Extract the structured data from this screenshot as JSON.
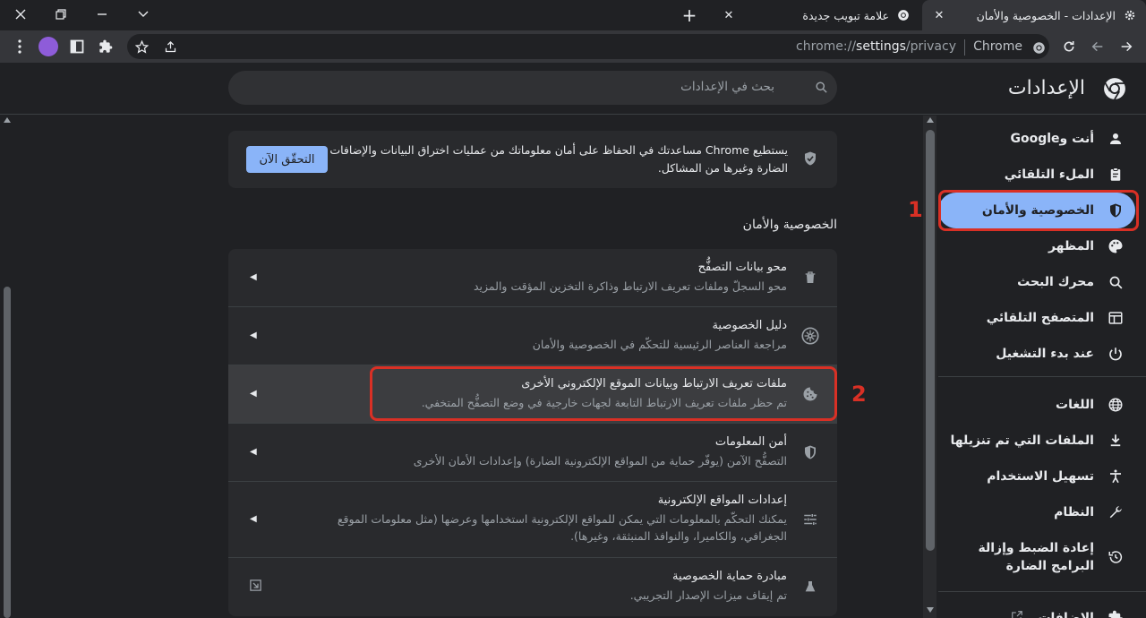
{
  "tabs": [
    {
      "title": "الإعدادات - الخصوصية والأمان",
      "icon": "settings-gear-icon",
      "active": true
    },
    {
      "title": "علامة تبويب جديدة",
      "icon": "chrome-icon",
      "active": false
    }
  ],
  "toolbar": {
    "url_prefix": "chrome://",
    "url_bold": "settings",
    "url_suffix": "/privacy",
    "chip": "Chrome"
  },
  "header": {
    "title": "الإعدادات",
    "search_placeholder": "بحث في الإعدادات"
  },
  "sidebar": {
    "items": [
      {
        "label": "أنت وGoogle",
        "icon": "person-icon"
      },
      {
        "label": "الملء التلقائي",
        "icon": "clipboard-icon"
      },
      {
        "label": "الخصوصية والأمان",
        "icon": "shield-icon",
        "selected": true
      },
      {
        "label": "المظهر",
        "icon": "palette-icon"
      },
      {
        "label": "محرك البحث",
        "icon": "search-icon"
      },
      {
        "label": "المتصفح التلقائي",
        "icon": "browser-icon"
      },
      {
        "label": "عند بدء التشغيل",
        "icon": "power-icon"
      },
      {
        "label": "اللغات",
        "icon": "globe-icon"
      },
      {
        "label": "الملفات التي تم تنزيلها",
        "icon": "download-icon"
      },
      {
        "label": "تسهيل الاستخدام",
        "icon": "accessibility-icon"
      },
      {
        "label": "النظام",
        "icon": "wrench-icon"
      },
      {
        "label": "إعادة الضبط وإزالة البرامج الضارة",
        "icon": "restore-icon"
      },
      {
        "label": "الإضافات",
        "icon": "puzzle-icon"
      }
    ]
  },
  "safety_check": {
    "text_line1": "يستطيع Chrome مساعدتك في الحفاظ على أمان معلوماتك من عمليات اختراق البيانات والإضافات",
    "text_line2": "الضارة وغيرها من المشاكل.",
    "button": "التحقّق الآن"
  },
  "section_title": "الخصوصية والأمان",
  "rows": [
    {
      "title": "محو بيانات التصفُّح",
      "subtitle": "محو السجلّ وملفات تعريف الارتباط وذاكرة التخزين المؤقت والمزيد",
      "icon": "trash-icon"
    },
    {
      "title": "دليل الخصوصية",
      "subtitle": "مراجعة العناصر الرئيسية للتحكّم في الخصوصية والأمان",
      "icon": "compass-icon"
    },
    {
      "title": "ملفات تعريف الارتباط وبيانات الموقع الإلكتروني الأخرى",
      "subtitle": "تم حظر ملفات تعريف الارتباط التابعة لجهات خارجية في وضع التصفُّح المتخفي.",
      "icon": "cookie-icon"
    },
    {
      "title": "أمن المعلومات",
      "subtitle": "التصفُّح الآمن (يوفّر حماية من المواقع الإلكترونية الضارة) وإعدادات الأمان الأخرى",
      "icon": "shield-icon"
    },
    {
      "title": "إعدادات المواقع الإلكترونية",
      "subtitle_line1": "يمكنك التحكّم بالمعلومات التي يمكن للمواقع الإلكترونية استخدامها وعرضها (مثل معلومات الموقع",
      "subtitle_line2": "الجغرافي، والكاميرا، والنوافذ المنبثقة، وغيرها).",
      "icon": "tune-icon"
    },
    {
      "title": "مبادرة حماية الخصوصية",
      "subtitle": "تم إيقاف ميزات الإصدار التجريبي.",
      "icon": "flask-icon"
    }
  ],
  "annotations": [
    "1",
    "2"
  ],
  "colors": {
    "accent": "#8ab4f8",
    "annotation_red": "#d93025",
    "background": "#202124",
    "card": "#292a2d"
  }
}
